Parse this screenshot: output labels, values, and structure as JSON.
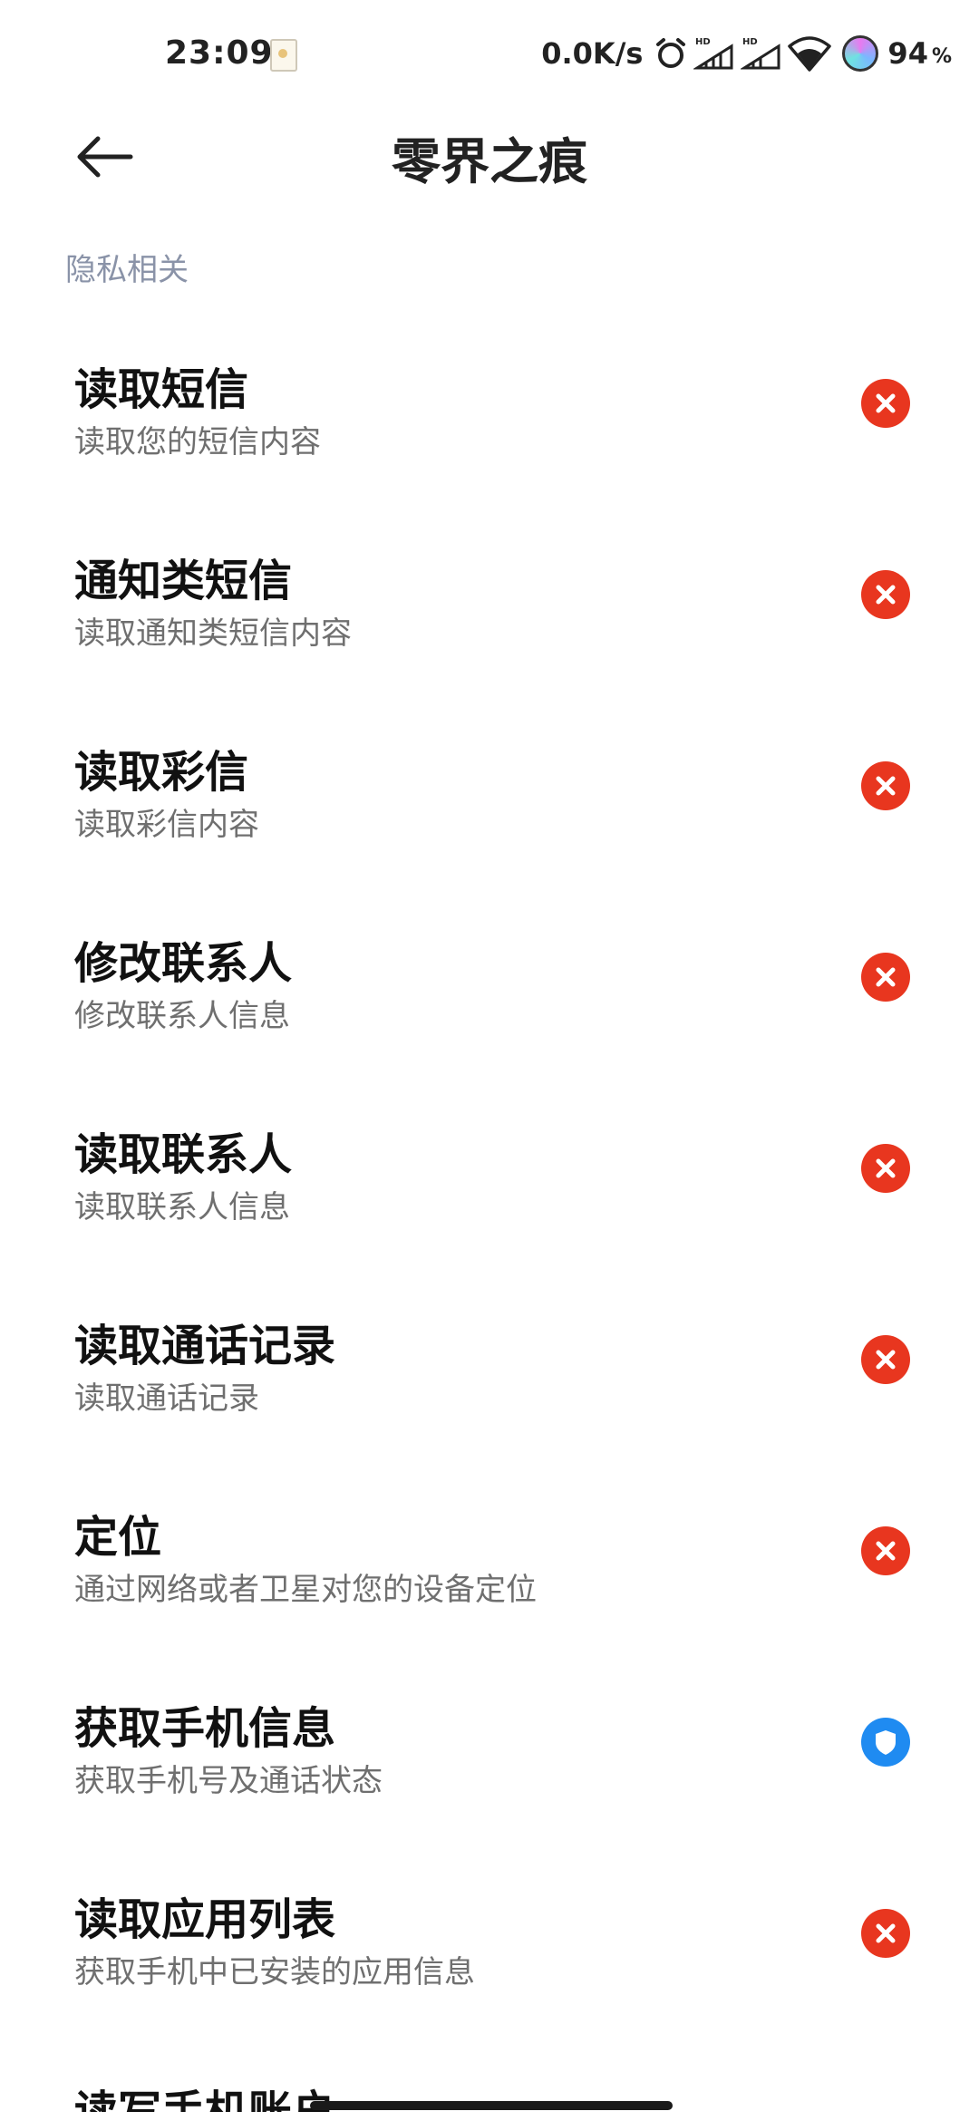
{
  "status_bar": {
    "time": "23:09",
    "speed": "0.0K/s",
    "battery": "94",
    "battery_unit": "%",
    "icons": [
      "notification-icon",
      "alarm-icon",
      "signal-hd-icon",
      "signal-hd-icon",
      "wifi-icon",
      "assistant-icon"
    ]
  },
  "header": {
    "title": "零界之痕"
  },
  "section": {
    "title": "隐私相关"
  },
  "permissions": [
    {
      "title": "读取短信",
      "desc": "读取您的短信内容",
      "status": "deny"
    },
    {
      "title": "通知类短信",
      "desc": "读取通知类短信内容",
      "status": "deny"
    },
    {
      "title": "读取彩信",
      "desc": "读取彩信内容",
      "status": "deny"
    },
    {
      "title": "修改联系人",
      "desc": "修改联系人信息",
      "status": "deny"
    },
    {
      "title": "读取联系人",
      "desc": "读取联系人信息",
      "status": "deny"
    },
    {
      "title": "读取通话记录",
      "desc": "读取通话记录",
      "status": "deny"
    },
    {
      "title": "定位",
      "desc": "通过网络或者卫星对您的设备定位",
      "status": "deny"
    },
    {
      "title": "获取手机信息",
      "desc": "获取手机号及通话状态",
      "status": "allow"
    },
    {
      "title": "读取应用列表",
      "desc": "获取手机中已安装的应用信息",
      "status": "deny"
    }
  ],
  "partial_item": {
    "title": "读写手机账户"
  },
  "colors": {
    "deny": "#e8361f",
    "allow": "#1f8bf1",
    "section": "#8a93a8"
  }
}
